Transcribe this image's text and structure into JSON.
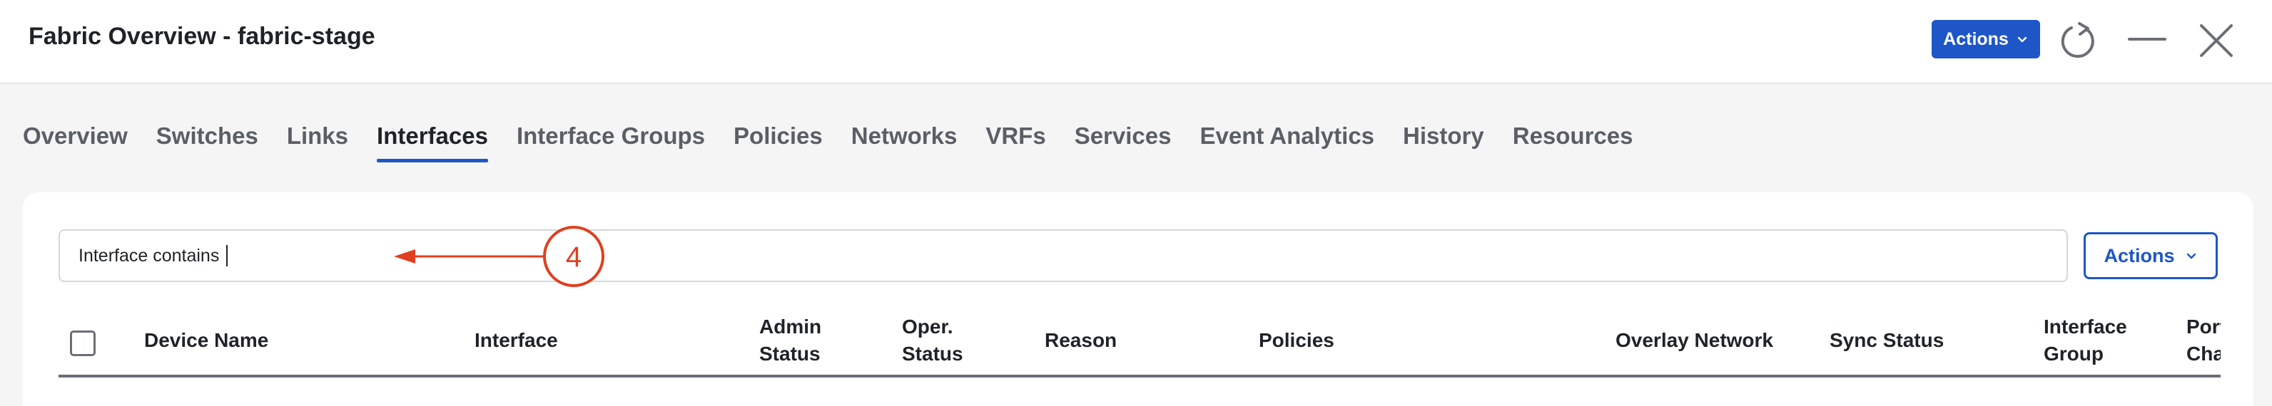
{
  "window": {
    "title": "Fabric Overview - fabric-stage",
    "actions_label": "Actions",
    "icons": [
      "refresh-icon",
      "minimize-icon",
      "close-icon"
    ]
  },
  "tabs": [
    {
      "label": "Overview"
    },
    {
      "label": "Switches"
    },
    {
      "label": "Links"
    },
    {
      "label": "Interfaces",
      "active": true
    },
    {
      "label": "Interface Groups"
    },
    {
      "label": "Policies"
    },
    {
      "label": "Networks"
    },
    {
      "label": "VRFs"
    },
    {
      "label": "Services"
    },
    {
      "label": "Event Analytics"
    },
    {
      "label": "History"
    },
    {
      "label": "Resources"
    }
  ],
  "filter": {
    "value": "Interface contains",
    "annotation_number": "4"
  },
  "card": {
    "actions_label": "Actions"
  },
  "table": {
    "columns": [
      {
        "line1": "Device Name",
        "line2": ""
      },
      {
        "line1": "Interface",
        "line2": ""
      },
      {
        "line1": "Admin",
        "line2": "Status"
      },
      {
        "line1": "Oper.",
        "line2": "Status"
      },
      {
        "line1": "Reason",
        "line2": ""
      },
      {
        "line1": "Policies",
        "line2": ""
      },
      {
        "line1": "Overlay Network",
        "line2": ""
      },
      {
        "line1": "Sync Status",
        "line2": ""
      },
      {
        "line1": "Interface",
        "line2": "Group"
      },
      {
        "line1": "Port",
        "line2": "Channel"
      }
    ]
  },
  "colors": {
    "brand_blue": "#1e56c8",
    "annotation_red": "#e0401f"
  }
}
